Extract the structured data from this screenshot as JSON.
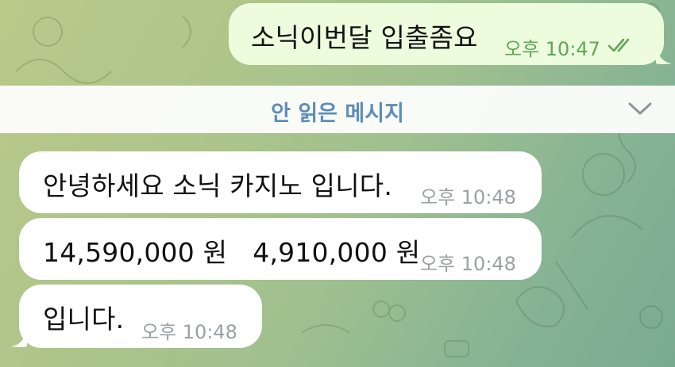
{
  "outgoing": {
    "text": "소닉이번달 입출좀요",
    "time": "오후 10:47",
    "status_icon": "double-check-icon"
  },
  "unread_divider": {
    "label": "안 읽은 메시지",
    "icon": "chevron-down-icon"
  },
  "incoming": [
    {
      "text": "안녕하세요 소닉 카지노 입니다.",
      "time": "오후 10:48"
    },
    {
      "text": "14,590,000 원   4,910,000 원",
      "time": "오후 10:48"
    },
    {
      "text": "입니다.",
      "time": "오후 10:48"
    }
  ],
  "colors": {
    "outgoing_bubble": "#eefcde",
    "incoming_bubble": "#ffffff",
    "unread_label": "#5e8db8",
    "outgoing_meta": "#5fa65a"
  }
}
